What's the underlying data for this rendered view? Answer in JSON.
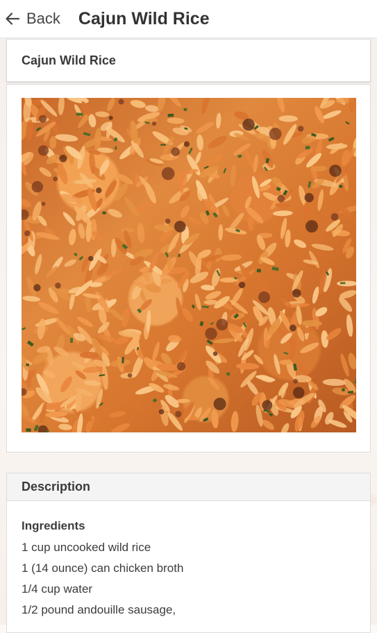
{
  "app_bar": {
    "back_label": "Back",
    "title": "Cajun Wild Rice"
  },
  "recipe": {
    "title": "Cajun Wild Rice",
    "description_header": "Description",
    "ingredients_heading": "Ingredients",
    "ingredients": [
      "1 cup uncooked wild rice",
      "1 (14 ounce) can chicken broth",
      "1/4 cup water",
      "1/2 pound andouille sausage,"
    ]
  },
  "icons": {
    "back": "arrow-left-icon"
  },
  "colors": {
    "app_bar_bg": "#ffffff",
    "card_bg": "#ffffff",
    "section_header_bg": "#f4f4f4",
    "text_primary": "#333333"
  }
}
